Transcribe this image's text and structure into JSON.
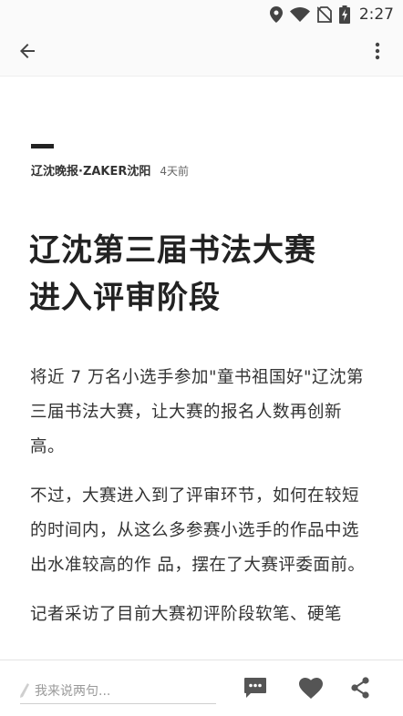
{
  "status_bar": {
    "time": "2:27",
    "icons": [
      "location-icon",
      "wifi-icon",
      "no-sim-icon",
      "battery-charging-icon"
    ]
  },
  "app_bar": {
    "icons": [
      "back-arrow-icon",
      "more-vertical-icon"
    ]
  },
  "article": {
    "source": "辽沈晚报·ZAKER沈阳",
    "time_ago": "4天前",
    "title_line1": "辽沈第三届书法大赛",
    "title_line2": "进入评审阶段",
    "paragraphs": [
      "将近 7 万名小选手参加\"童书祖国好\"辽沈第三届书法大赛，让大赛的报名人数再创新高。",
      "不过，大赛进入到了评审环节，如何在较短的时间内，从这么多参赛小选手的作品中选出水准较高的作 品，摆在了大赛评委面前。",
      "记者采访了目前大赛初评阶段软笔、硬笔"
    ]
  },
  "bottom_bar": {
    "comment_placeholder": "我来说两句...",
    "icons": [
      "pen-icon",
      "comments-icon",
      "heart-icon",
      "share-icon"
    ]
  },
  "colors": {
    "text_primary": "#222222",
    "text_secondary": "#666666",
    "icon_gray": "#555555"
  }
}
